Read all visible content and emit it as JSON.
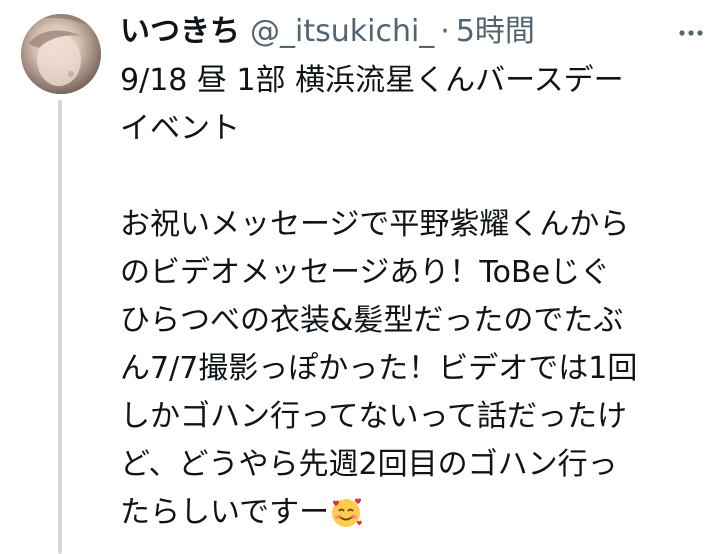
{
  "tweet": {
    "author": {
      "display_name": "いつきち",
      "handle": "@_itsukichi_",
      "separator": "·",
      "timestamp": "5時間"
    },
    "text_lines": [
      "9/18 昼 1部 横浜流星くんバースデー",
      "イベント",
      "",
      "お祝いメッセージで平野紫耀くんから",
      "のビデオメッセージあり！ToBeじぐ",
      "ひらつべの衣装&髪型だったのでたぶ",
      "ん7/7撮影っぽかった！ビデオでは1回",
      "しかゴハン行ってないって話だったけ",
      "ど、どうやら先週2回目のゴハン行っ"
    ],
    "last_line": "たらしいですー",
    "emoji": "smiling-face-with-hearts",
    "more_icon": "more-dots-icon"
  }
}
